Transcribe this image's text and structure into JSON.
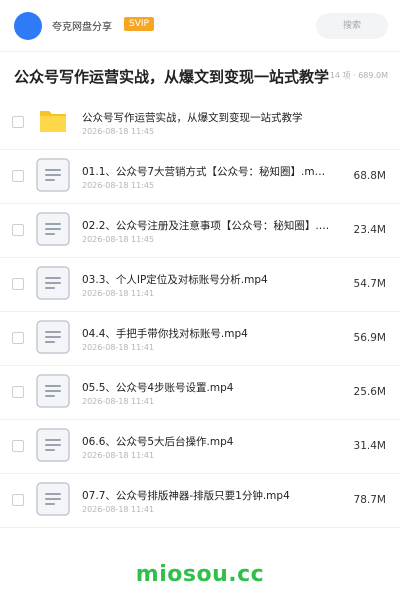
{
  "header": {
    "brand": "夸克网盘分享",
    "badge": "SVIP",
    "search_placeholder": "搜索",
    "avatar_color": "#2f7af7",
    "badge_color": "#f6a623"
  },
  "folder": {
    "title": "公众号写作运营实战，从爆文到变现一站式教学",
    "summary": "14 项 · 689.0M"
  },
  "files": [
    {
      "name": "公众号写作运营实战，从爆文到变现一站式教学",
      "date": "2026-08-18 11:45",
      "size": "",
      "type": "folder-icon"
    },
    {
      "name": "01.1、公众号7大营销方式【公众号：秘知圈】.m…",
      "date": "2026-08-18 11:45",
      "size": "68.8M",
      "type": "video-file-icon"
    },
    {
      "name": "02.2、公众号注册及注意事项【公众号：秘知圈】.…",
      "date": "2026-08-18 11:45",
      "size": "23.4M",
      "type": "video-file-icon"
    },
    {
      "name": "03.3、个人IP定位及对标账号分析.mp4",
      "date": "2026-08-18 11:41",
      "size": "54.7M",
      "type": "video-file-icon"
    },
    {
      "name": "04.4、手把手带你找对标账号.mp4",
      "date": "2026-08-18 11:41",
      "size": "56.9M",
      "type": "video-file-icon"
    },
    {
      "name": "05.5、公众号4步账号设置.mp4",
      "date": "2026-08-18 11:41",
      "size": "25.6M",
      "type": "video-file-icon"
    },
    {
      "name": "06.6、公众号5大后台操作.mp4",
      "date": "2026-08-18 11:41",
      "size": "31.4M",
      "type": "video-file-icon"
    },
    {
      "name": "07.7、公众号排版神器-排版只要1分钟.mp4",
      "date": "2026-08-18 11:41",
      "size": "78.7M",
      "type": "video-file-icon"
    }
  ],
  "watermark": "miosou.cc"
}
